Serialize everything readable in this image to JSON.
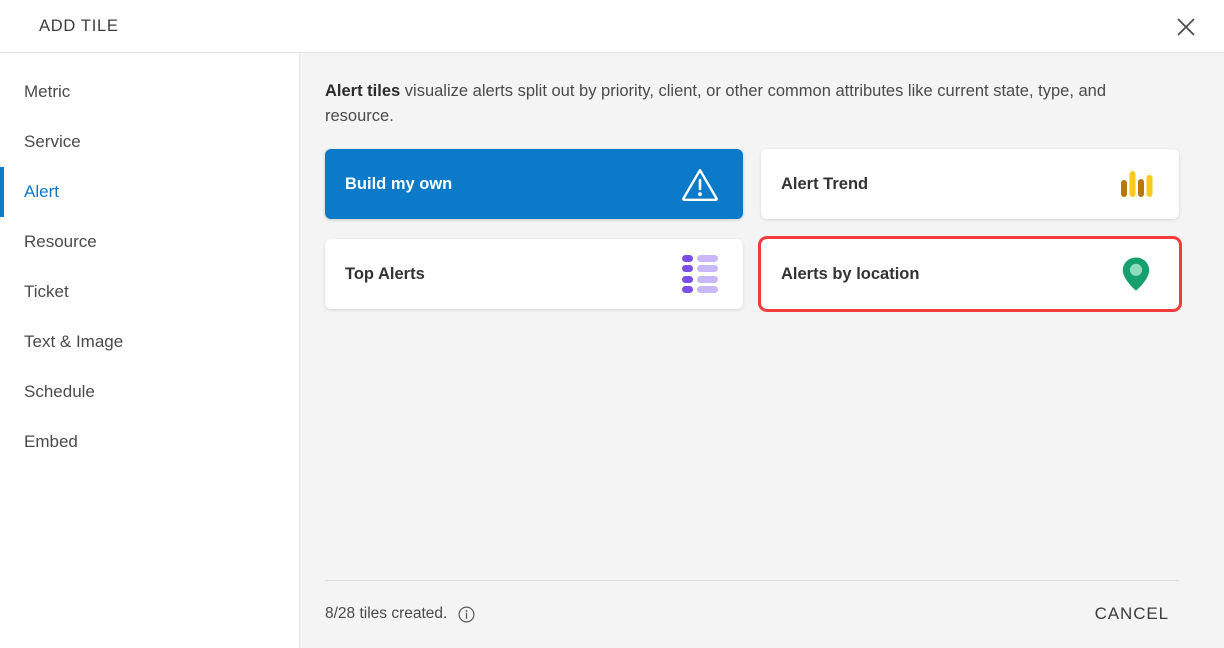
{
  "header": {
    "title": "ADD TILE",
    "close_icon": "close-icon"
  },
  "sidebar": {
    "items": [
      {
        "label": "Metric",
        "active": false
      },
      {
        "label": "Service",
        "active": false
      },
      {
        "label": "Alert",
        "active": true
      },
      {
        "label": "Resource",
        "active": false
      },
      {
        "label": "Ticket",
        "active": false
      },
      {
        "label": "Text & Image",
        "active": false
      },
      {
        "label": "Schedule",
        "active": false
      },
      {
        "label": "Embed",
        "active": false
      }
    ]
  },
  "main": {
    "description_strong": "Alert tiles",
    "description_rest": " visualize alerts split out by priority, client, or other common attributes like current state, type, and resource.",
    "tiles": [
      {
        "label": "Build my own",
        "icon": "warning-triangle-icon",
        "style": "primary",
        "highlighted": false
      },
      {
        "label": "Alert Trend",
        "icon": "bar-chart-icon",
        "style": "default",
        "highlighted": false
      },
      {
        "label": "Top Alerts",
        "icon": "list-icon",
        "style": "default",
        "highlighted": false
      },
      {
        "label": "Alerts by location",
        "icon": "map-pin-icon",
        "style": "default",
        "highlighted": true
      }
    ]
  },
  "footer": {
    "tiles_created": "8/28 tiles created.",
    "info_icon": "info-icon",
    "cancel_label": "CANCEL"
  },
  "colors": {
    "accent_blue": "#0b7ac9",
    "highlight_red": "#f23b3b",
    "panel_gray": "#f4f4f4",
    "chart_amber": "#b8780a",
    "chart_yellow": "#ffc81e",
    "list_purple": "#7a4fe8",
    "list_lavender": "#c8b8f7",
    "pin_green": "#16a06f",
    "pin_green_light": "#8fdcbd"
  }
}
